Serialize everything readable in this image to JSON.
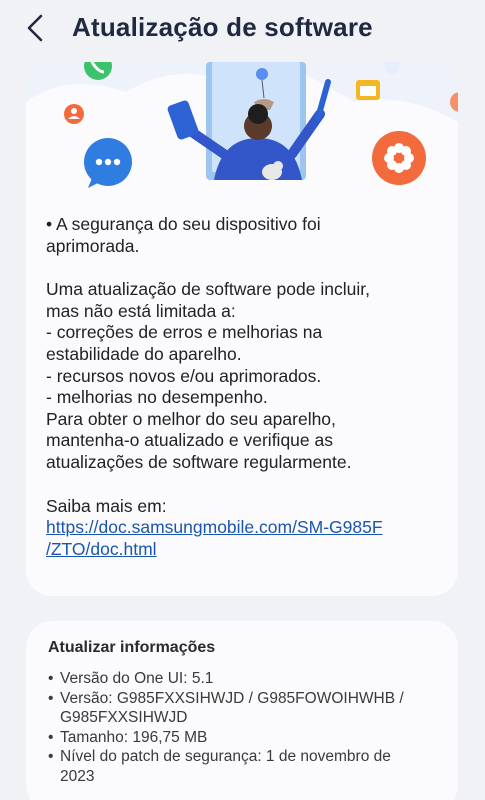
{
  "header": {
    "title": "Atualização de software",
    "back_icon": "chevron-left-icon"
  },
  "main_card": {
    "illustration_icons": [
      "phone-call-icon",
      "chat-bubble-icon",
      "person-badge-icon",
      "flower-icon",
      "calendar-icon",
      "stylus-icon",
      "balloon-icon"
    ],
    "security_line": "• A segurança do seu dispositivo foi\naprimorada.",
    "update_intro": "Uma atualização de software pode incluir,\nmas não está limitada a:",
    "item_1": " - correções de erros e melhorias na\nestabilidade do aparelho.",
    "item_2": " - recursos novos e/ou aprimorados.",
    "item_3": " - melhorias no desempenho.",
    "closing": "Para obter o melhor do seu aparelho,\nmantenha-o atualizado e verifique as\natualizações de software regularmente.",
    "learn_more": "Saiba mais em:",
    "link_line_1": "https://doc.samsungmobile.com/SM-G985F",
    "link_line_2": "/ZTO/doc.html"
  },
  "info_card": {
    "title": "Atualizar informações",
    "one_ui": "Versão do One UI: 5.1",
    "version": "Versão: G985FXXSIHWJD / G985FOWOIHWHB /\nG985FXXSIHWJD",
    "size": "Tamanho: 196,75 MB",
    "patch": "Nível do patch de segurança: 1 de novembro de\n2023"
  },
  "colors": {
    "background": "#f1f2f6",
    "card": "#fbfbfd",
    "title": "#1f2a40",
    "link": "#1a56b0",
    "accent_orange": "#f36a3c",
    "accent_blue": "#2f7de1",
    "accent_green": "#3cc26a"
  }
}
